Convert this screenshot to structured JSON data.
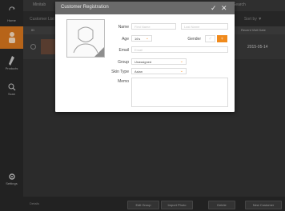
{
  "background": {
    "top_title": "Minitab",
    "top_right": "Search",
    "sub_left": "Customer List",
    "sub_right": "Sort by ▼",
    "header_left": "ID",
    "header_right": "Recent Visit Date",
    "row_date": "2015-05-14",
    "footer_left": "Details",
    "buttons": [
      "Edit Group",
      "Import Photo",
      "Delete",
      "New Customer"
    ]
  },
  "rail": {
    "items": [
      {
        "label": "",
        "icon": "refresh-icon"
      },
      {
        "label": "Home",
        "icon": "home-icon"
      },
      {
        "label": "",
        "icon": "person-icon"
      },
      {
        "label": "Products",
        "icon": "product-icon"
      },
      {
        "label": "Scan",
        "icon": "search-icon"
      },
      {
        "label": "Settings",
        "icon": "gear-icon"
      }
    ]
  },
  "modal": {
    "title": "Customer Registration",
    "confirm_icon": "✓",
    "close_icon": "✕",
    "name_label": "Name",
    "first_placeholder": "First Name",
    "last_placeholder": "Last Name",
    "age_label": "Age",
    "age_value": "16's",
    "gender_label": "Gender",
    "male_symbol": "♂",
    "female_symbol": "♀",
    "email_label": "Email",
    "email_placeholder": "Email",
    "group_label": "Group",
    "group_value": "Unassigned",
    "skin_label": "Skin Type",
    "skin_value": "Asian",
    "memo_label": "Memo"
  },
  "colors": {
    "accent": "#f08a1c"
  }
}
